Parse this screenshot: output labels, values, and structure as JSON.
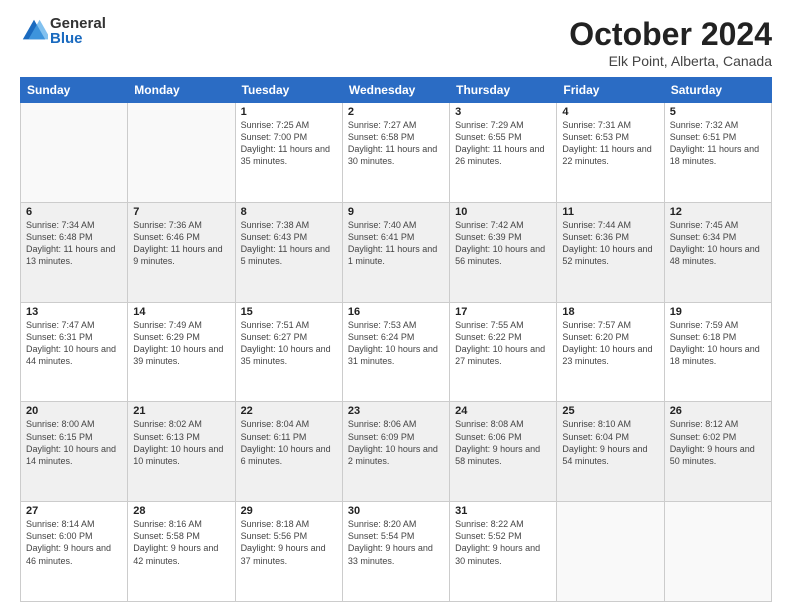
{
  "logo": {
    "general": "General",
    "blue": "Blue"
  },
  "title": "October 2024",
  "location": "Elk Point, Alberta, Canada",
  "weekdays": [
    "Sunday",
    "Monday",
    "Tuesday",
    "Wednesday",
    "Thursday",
    "Friday",
    "Saturday"
  ],
  "weeks": [
    [
      {
        "day": "",
        "info": ""
      },
      {
        "day": "",
        "info": ""
      },
      {
        "day": "1",
        "info": "Sunrise: 7:25 AM\nSunset: 7:00 PM\nDaylight: 11 hours and 35 minutes."
      },
      {
        "day": "2",
        "info": "Sunrise: 7:27 AM\nSunset: 6:58 PM\nDaylight: 11 hours and 30 minutes."
      },
      {
        "day": "3",
        "info": "Sunrise: 7:29 AM\nSunset: 6:55 PM\nDaylight: 11 hours and 26 minutes."
      },
      {
        "day": "4",
        "info": "Sunrise: 7:31 AM\nSunset: 6:53 PM\nDaylight: 11 hours and 22 minutes."
      },
      {
        "day": "5",
        "info": "Sunrise: 7:32 AM\nSunset: 6:51 PM\nDaylight: 11 hours and 18 minutes."
      }
    ],
    [
      {
        "day": "6",
        "info": "Sunrise: 7:34 AM\nSunset: 6:48 PM\nDaylight: 11 hours and 13 minutes."
      },
      {
        "day": "7",
        "info": "Sunrise: 7:36 AM\nSunset: 6:46 PM\nDaylight: 11 hours and 9 minutes."
      },
      {
        "day": "8",
        "info": "Sunrise: 7:38 AM\nSunset: 6:43 PM\nDaylight: 11 hours and 5 minutes."
      },
      {
        "day": "9",
        "info": "Sunrise: 7:40 AM\nSunset: 6:41 PM\nDaylight: 11 hours and 1 minute."
      },
      {
        "day": "10",
        "info": "Sunrise: 7:42 AM\nSunset: 6:39 PM\nDaylight: 10 hours and 56 minutes."
      },
      {
        "day": "11",
        "info": "Sunrise: 7:44 AM\nSunset: 6:36 PM\nDaylight: 10 hours and 52 minutes."
      },
      {
        "day": "12",
        "info": "Sunrise: 7:45 AM\nSunset: 6:34 PM\nDaylight: 10 hours and 48 minutes."
      }
    ],
    [
      {
        "day": "13",
        "info": "Sunrise: 7:47 AM\nSunset: 6:31 PM\nDaylight: 10 hours and 44 minutes."
      },
      {
        "day": "14",
        "info": "Sunrise: 7:49 AM\nSunset: 6:29 PM\nDaylight: 10 hours and 39 minutes."
      },
      {
        "day": "15",
        "info": "Sunrise: 7:51 AM\nSunset: 6:27 PM\nDaylight: 10 hours and 35 minutes."
      },
      {
        "day": "16",
        "info": "Sunrise: 7:53 AM\nSunset: 6:24 PM\nDaylight: 10 hours and 31 minutes."
      },
      {
        "day": "17",
        "info": "Sunrise: 7:55 AM\nSunset: 6:22 PM\nDaylight: 10 hours and 27 minutes."
      },
      {
        "day": "18",
        "info": "Sunrise: 7:57 AM\nSunset: 6:20 PM\nDaylight: 10 hours and 23 minutes."
      },
      {
        "day": "19",
        "info": "Sunrise: 7:59 AM\nSunset: 6:18 PM\nDaylight: 10 hours and 18 minutes."
      }
    ],
    [
      {
        "day": "20",
        "info": "Sunrise: 8:00 AM\nSunset: 6:15 PM\nDaylight: 10 hours and 14 minutes."
      },
      {
        "day": "21",
        "info": "Sunrise: 8:02 AM\nSunset: 6:13 PM\nDaylight: 10 hours and 10 minutes."
      },
      {
        "day": "22",
        "info": "Sunrise: 8:04 AM\nSunset: 6:11 PM\nDaylight: 10 hours and 6 minutes."
      },
      {
        "day": "23",
        "info": "Sunrise: 8:06 AM\nSunset: 6:09 PM\nDaylight: 10 hours and 2 minutes."
      },
      {
        "day": "24",
        "info": "Sunrise: 8:08 AM\nSunset: 6:06 PM\nDaylight: 9 hours and 58 minutes."
      },
      {
        "day": "25",
        "info": "Sunrise: 8:10 AM\nSunset: 6:04 PM\nDaylight: 9 hours and 54 minutes."
      },
      {
        "day": "26",
        "info": "Sunrise: 8:12 AM\nSunset: 6:02 PM\nDaylight: 9 hours and 50 minutes."
      }
    ],
    [
      {
        "day": "27",
        "info": "Sunrise: 8:14 AM\nSunset: 6:00 PM\nDaylight: 9 hours and 46 minutes."
      },
      {
        "day": "28",
        "info": "Sunrise: 8:16 AM\nSunset: 5:58 PM\nDaylight: 9 hours and 42 minutes."
      },
      {
        "day": "29",
        "info": "Sunrise: 8:18 AM\nSunset: 5:56 PM\nDaylight: 9 hours and 37 minutes."
      },
      {
        "day": "30",
        "info": "Sunrise: 8:20 AM\nSunset: 5:54 PM\nDaylight: 9 hours and 33 minutes."
      },
      {
        "day": "31",
        "info": "Sunrise: 8:22 AM\nSunset: 5:52 PM\nDaylight: 9 hours and 30 minutes."
      },
      {
        "day": "",
        "info": ""
      },
      {
        "day": "",
        "info": ""
      }
    ]
  ]
}
